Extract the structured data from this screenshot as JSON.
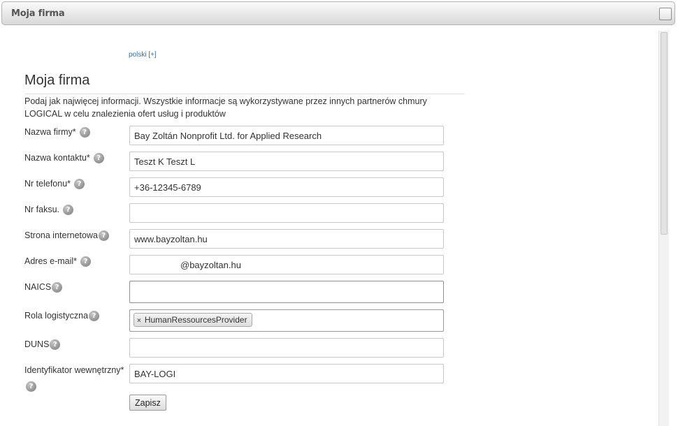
{
  "window": {
    "title": "Moja firma"
  },
  "language_link": "polski [+]",
  "form": {
    "heading": "Moja firma",
    "intro": "Podaj jak najwięcej informacji. Wszystkie informacje są wykorzystywane przez innych partnerów chmury LOGICAL w celu znalezienia ofert usług i produktów",
    "help_icon_glyph": "?",
    "fields": {
      "company_name": {
        "label": "Nazwa firmy*",
        "value": "Bay Zoltán Nonprofit Ltd. for Applied Research"
      },
      "contact_name": {
        "label": "Nazwa kontaktu*",
        "value": "Teszt K Teszt L"
      },
      "phone": {
        "label": "Nr telefonu*",
        "value": "+36-12345-6789"
      },
      "fax": {
        "label": "Nr faksu.",
        "value": ""
      },
      "website": {
        "label": "Strona internetowa",
        "value": "www.bayzoltan.hu"
      },
      "email": {
        "label": "Adres e-mail*",
        "value": "@bayzoltan.hu"
      },
      "naics": {
        "label": "NAICS",
        "value": ""
      },
      "logistics_role": {
        "label": "Rola logistyczna",
        "tags": [
          "HumanRessourcesProvider"
        ],
        "tag_remove_glyph": "×"
      },
      "duns": {
        "label": "DUNS",
        "value": ""
      },
      "internal_id": {
        "label": "Identyfikator wewnętrzny*",
        "value": "BAY-LOGI"
      }
    },
    "save_label": "Zapisz"
  }
}
